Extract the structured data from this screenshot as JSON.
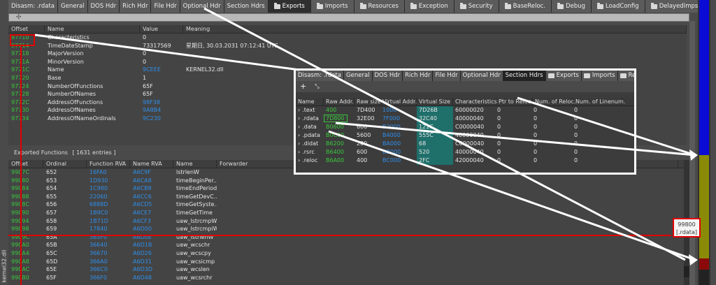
{
  "tabs": [
    {
      "label": "Disasm: .rdata",
      "folder": false,
      "active": false
    },
    {
      "label": "General",
      "folder": false,
      "active": false
    },
    {
      "label": "DOS Hdr",
      "folder": false,
      "active": false
    },
    {
      "label": "Rich Hdr",
      "folder": false,
      "active": false
    },
    {
      "label": "File Hdr",
      "folder": false,
      "active": false
    },
    {
      "label": "Optional Hdr",
      "folder": false,
      "active": false
    },
    {
      "label": "Section Hdrs",
      "folder": false,
      "active": false
    },
    {
      "label": "Exports",
      "folder": true,
      "active": true
    },
    {
      "label": "Imports",
      "folder": true,
      "active": false
    },
    {
      "label": "Resources",
      "folder": true,
      "active": false
    },
    {
      "label": "Exception",
      "folder": true,
      "active": false
    },
    {
      "label": "Security",
      "folder": true,
      "active": false
    },
    {
      "label": "BaseReloc.",
      "folder": true,
      "active": false
    },
    {
      "label": "Debug",
      "folder": true,
      "active": false
    },
    {
      "label": "LoadConfig",
      "folder": true,
      "active": false
    },
    {
      "label": "DelayedImps",
      "folder": true,
      "active": false
    }
  ],
  "toolbar": {
    "move_icon": "✣"
  },
  "side_caption": "kernel32.dll",
  "export_dir": {
    "headers": [
      "Offset",
      "Name",
      "Value",
      "Meaning"
    ],
    "rows": [
      {
        "offset": "97710",
        "name": "Characteristics",
        "value": "0",
        "meaning": "",
        "value_blue": false
      },
      {
        "offset": "97714",
        "name": "TimeDateStamp",
        "value": "73317569",
        "meaning": "星期日, 30.03.2031 07:12:41 UTC",
        "value_blue": false
      },
      {
        "offset": "97718",
        "name": "MajorVersion",
        "value": "0",
        "meaning": "",
        "value_blue": false
      },
      {
        "offset": "9771A",
        "name": "MinorVersion",
        "value": "0",
        "meaning": "",
        "value_blue": false
      },
      {
        "offset": "9771C",
        "name": "Name",
        "value": "9CEEE",
        "meaning": "KERNEL32.dll",
        "value_blue": true
      },
      {
        "offset": "97720",
        "name": "Base",
        "value": "1",
        "meaning": "",
        "value_blue": false
      },
      {
        "offset": "97724",
        "name": "NumberOfFunctions",
        "value": "65F",
        "meaning": "",
        "value_blue": false
      },
      {
        "offset": "97728",
        "name": "NumberOfNames",
        "value": "65F",
        "meaning": "",
        "value_blue": false
      },
      {
        "offset": "9772C",
        "name": "AddressOfFunctions",
        "value": "98F38",
        "meaning": "",
        "value_blue": true
      },
      {
        "offset": "97730",
        "name": "AddressOfNames",
        "value": "9A8B4",
        "meaning": "",
        "value_blue": true
      },
      {
        "offset": "97734",
        "name": "AddressOfNameOrdinals",
        "value": "9C230",
        "meaning": "",
        "value_blue": true
      }
    ]
  },
  "exported_functions": {
    "title": "Exported Functions",
    "count": "[ 1631 entries ]",
    "headers": [
      "Offset",
      "Ordinal",
      "Function RVA",
      "Name RVA",
      "Name",
      "Forwarder"
    ],
    "rows": [
      {
        "offset": "9907C",
        "ordinal": "652",
        "frva": "16FA0",
        "nrva": "A6C9F",
        "name": "lstrlenW"
      },
      {
        "offset": "99080",
        "ordinal": "653",
        "frva": "1D930",
        "nrva": "A6CA8",
        "name": "timeBeginPer..."
      },
      {
        "offset": "99084",
        "ordinal": "654",
        "frva": "1C980",
        "nrva": "A6CB8",
        "name": "timeEndPeriod"
      },
      {
        "offset": "99088",
        "ordinal": "655",
        "frva": "22060",
        "nrva": "A6CC6",
        "name": "timeGetDevC..."
      },
      {
        "offset": "9908C",
        "ordinal": "656",
        "frva": "6888D",
        "nrva": "A6CD5",
        "name": "timeGetSyste..."
      },
      {
        "offset": "99090",
        "ordinal": "657",
        "frva": "1B9C0",
        "nrva": "A6CE7",
        "name": "timeGetTime"
      },
      {
        "offset": "99094",
        "ordinal": "658",
        "frva": "1B71D",
        "nrva": "A6CF3",
        "name": "uaw_lstrcmpW"
      },
      {
        "offset": "99098",
        "ordinal": "659",
        "frva": "17840",
        "nrva": "A6D00",
        "name": "uaw_lstrcmpiW"
      },
      {
        "offset": "9909C",
        "ordinal": "65A",
        "frva": "365F0",
        "nrva": "A6D0E",
        "name": "uaw_lstrlenW"
      },
      {
        "offset": "990A0",
        "ordinal": "65B",
        "frva": "36640",
        "nrva": "A6D1B",
        "name": "uaw_wcschr"
      },
      {
        "offset": "990A4",
        "ordinal": "65C",
        "frva": "36670",
        "nrva": "A6D26",
        "name": "uaw_wcscpy"
      },
      {
        "offset": "990A8",
        "ordinal": "65D",
        "frva": "366A0",
        "nrva": "A6D31",
        "name": "uaw_wcsicmp"
      },
      {
        "offset": "990AC",
        "ordinal": "65E",
        "frva": "366C0",
        "nrva": "A6D3D",
        "name": "uaw_wcslen"
      },
      {
        "offset": "990B0",
        "ordinal": "65F",
        "frva": "366F0",
        "nrva": "A6D48",
        "name": "uaw_wcsrchr"
      }
    ]
  },
  "callout": {
    "address": "99800",
    "section": "[.rdata]"
  },
  "inset": {
    "tabs": [
      {
        "label": "Disasm: .rdata",
        "folder": false,
        "active": false
      },
      {
        "label": "General",
        "folder": false,
        "active": false
      },
      {
        "label": "DOS Hdr",
        "folder": false,
        "active": false
      },
      {
        "label": "Rich Hdr",
        "folder": false,
        "active": false
      },
      {
        "label": "File Hdr",
        "folder": false,
        "active": false
      },
      {
        "label": "Optional Hdr",
        "folder": false,
        "active": false
      },
      {
        "label": "Section Hdrs",
        "folder": false,
        "active": true
      },
      {
        "label": "Exports",
        "folder": true,
        "active": false
      },
      {
        "label": "Imports",
        "folder": true,
        "active": false
      },
      {
        "label": "Resource",
        "folder": true,
        "active": false
      }
    ],
    "toolbar": {
      "add_icon": "+",
      "collapse_icon": "⤡"
    },
    "headers": [
      "Name",
      "Raw Addr.",
      "Raw size",
      "Virtual Addr.",
      "Virtual Size",
      "Characteristics",
      "Ptr to Reloc.",
      "Num. of Reloc.",
      "Num. of Linenum."
    ],
    "rows": [
      {
        "name": ".text",
        "raw": "400",
        "rsz": "7D400",
        "vaddr": "1000",
        "vsize": "7D26B",
        "chars": "60000020",
        "ptr": "0",
        "nrel": "0",
        "nlin": "0"
      },
      {
        "name": ".rdata",
        "raw": "7D800",
        "rsz": "32E00",
        "vaddr": "7F000",
        "vsize": "32C40",
        "chars": "40000040",
        "ptr": "0",
        "nrel": "0",
        "nlin": "0"
      },
      {
        "name": ".data",
        "raw": "B0600",
        "rsz": "600",
        "vaddr": "B2000",
        "vsize": "121C",
        "chars": "C0000040",
        "ptr": "0",
        "nrel": "0",
        "nlin": "0"
      },
      {
        "name": ".pdata",
        "raw": "B0C00",
        "rsz": "5600",
        "vaddr": "B4000",
        "vsize": "555C",
        "chars": "40000040",
        "ptr": "0",
        "nrel": "0",
        "nlin": "0"
      },
      {
        "name": ".didat",
        "raw": "B6200",
        "rsz": "200",
        "vaddr": "BA000",
        "vsize": "68",
        "chars": "C0000040",
        "ptr": "0",
        "nrel": "0",
        "nlin": "0"
      },
      {
        "name": ".rsrc",
        "raw": "B6400",
        "rsz": "600",
        "vaddr": "BB000",
        "vsize": "520",
        "chars": "40000040",
        "ptr": "0",
        "nrel": "0",
        "nlin": "0"
      },
      {
        "name": ".reloc",
        "raw": "B6A00",
        "rsz": "400",
        "vaddr": "BC000",
        "vsize": "2FC",
        "chars": "42000040",
        "ptr": "0",
        "nrel": "0",
        "nlin": "0"
      }
    ]
  },
  "colors": {
    "offset_green": "#39c93d",
    "link_blue": "#2f8ee8",
    "highlight_red": "#e00000",
    "vsize_teal": "#1f6f6b"
  }
}
